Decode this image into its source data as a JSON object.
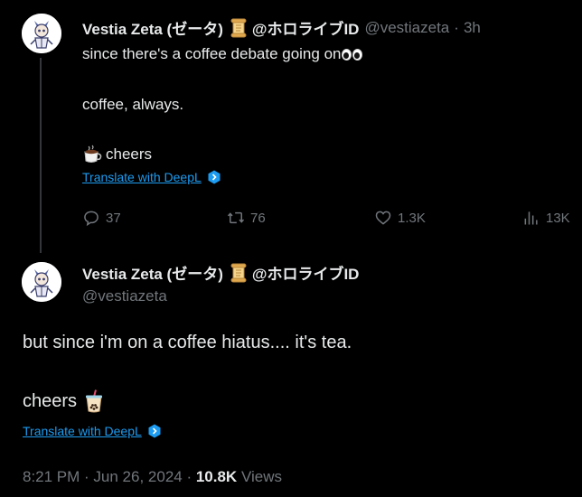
{
  "tweet1": {
    "display_name": "Vestia Zeta (ゼータ)",
    "affiliation": "@ホロライブID",
    "handle": "@vestiazeta",
    "separator": "·",
    "time": "3h",
    "line1": "since there's a coffee debate going on",
    "line2": "coffee, always.",
    "line3": "cheers",
    "translate_label": "Translate with DeepL",
    "replies": "37",
    "reposts": "76",
    "likes": "1.3K",
    "views": "13K"
  },
  "tweet2": {
    "display_name": "Vestia Zeta (ゼータ)",
    "affiliation": "@ホロライブID",
    "handle": "@vestiazeta",
    "line1": "but since i'm on a coffee hiatus.... it's tea.",
    "line2": "cheers",
    "translate_label": "Translate with DeepL",
    "timestamp": "8:21 PM · Jun 26, 2024 · ",
    "view_count": "10.8K",
    "views_label": " Views"
  },
  "icons": {
    "reply": "reply-icon",
    "repost": "repost-icon",
    "like": "heart-icon",
    "views": "views-icon",
    "deepl": "deepl-icon",
    "scroll": "scroll-emoji-icon"
  },
  "colors": {
    "background": "#000000",
    "text": "#e7e9ea",
    "muted": "#71767b",
    "link": "#1d9bf0"
  }
}
